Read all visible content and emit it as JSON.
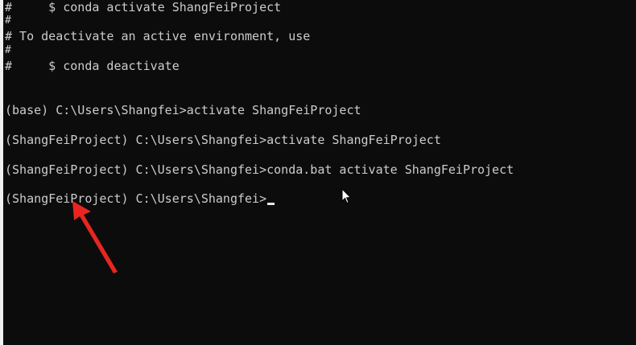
{
  "terminal": {
    "lines": {
      "l0": "#     $ conda activate ShangFeiProject",
      "l1": "#",
      "l2": "# To deactivate an active environment, use",
      "l3": "#",
      "l4": "#     $ conda deactivate",
      "l5": "(base) C:\\Users\\Shangfei>activate ShangFeiProject",
      "l6": "(ShangFeiProject) C:\\Users\\Shangfei>activate ShangFeiProject",
      "l7": "(ShangFeiProject) C:\\Users\\Shangfei>conda.bat activate ShangFeiProject",
      "l8": "(ShangFeiProject) C:\\Users\\Shangfei>"
    },
    "colors": {
      "background": "#0c0c0c",
      "text": "#cccccc",
      "annotation_arrow": "#e8261f"
    }
  },
  "icons": {
    "mouse_pointer": "mouse-pointer-icon",
    "annotation": "red-arrow-icon"
  }
}
